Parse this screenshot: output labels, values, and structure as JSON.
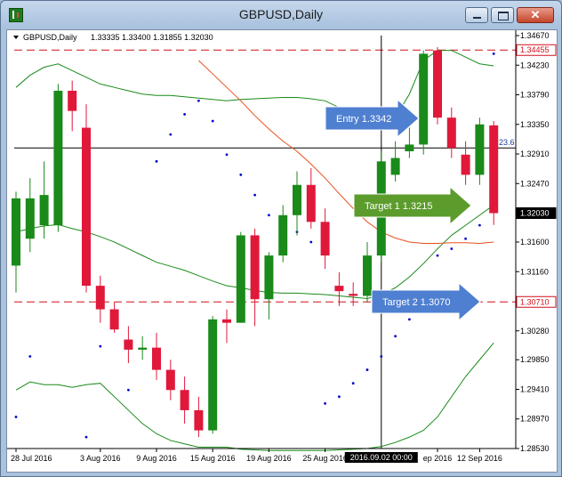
{
  "window": {
    "title": "GBPUSD,Daily",
    "buttons": {
      "minimize": "minimize",
      "maximize": "maximize",
      "close": "✕"
    }
  },
  "chart_info": {
    "symbol_label": "GBPUSD,Daily",
    "ohlc": "1.33335 1.33400 1.31855 1.32030"
  },
  "crosshair_time_label": "2016.09.02 00:00",
  "fib_label": "23.6",
  "colors": {
    "bull": "#1a8a1a",
    "bear": "#e0183a",
    "bollinger": "#1a8a1a",
    "moving_average": "#e8501e",
    "psar_dots": "#0000cc",
    "hline": "#d0101c",
    "callout_fill": "#4f7fd0",
    "target1_fill": "#5c9c2c"
  },
  "annotations": {
    "entry": "Entry 1.3342",
    "target1": "Target  1 1.3215",
    "target2": "Target 2 1.3070"
  },
  "chart_data": {
    "type": "candlestick",
    "title": "GBPUSD,Daily",
    "ylim": [
      1.2853,
      1.3467
    ],
    "y_ticks": [
      "1.34670",
      "1.34230",
      "1.33790",
      "1.33350",
      "1.32910",
      "1.32470",
      "1.31600",
      "1.31160",
      "1.30280",
      "1.29850",
      "1.29410",
      "1.28970",
      "1.28530"
    ],
    "price_labels": [
      {
        "value": 1.34455,
        "text": "1.34455",
        "style": "red"
      },
      {
        "value": 1.3203,
        "text": "1.32030",
        "style": "black"
      },
      {
        "value": 1.3071,
        "text": "1.30710",
        "style": "red"
      }
    ],
    "x_ticks": [
      {
        "index": 0,
        "label": "28 Jul 2016"
      },
      {
        "index": 6,
        "label": "3 Aug 2016"
      },
      {
        "index": 10,
        "label": "9 Aug 2016"
      },
      {
        "index": 14,
        "label": "15 Aug 2016"
      },
      {
        "index": 18,
        "label": "19 Aug 2016"
      },
      {
        "index": 22,
        "label": "25 Aug 2016"
      },
      {
        "index": 30,
        "label": "ep 2016"
      },
      {
        "index": 33,
        "label": "12 Sep 2016"
      }
    ],
    "crosshair": {
      "index": 26,
      "price": 1.33
    },
    "horizontal_lines": [
      1.34455,
      1.3071
    ],
    "candles": [
      {
        "o": 1.3125,
        "h": 1.3235,
        "l": 1.3085,
        "c": 1.3225
      },
      {
        "o": 1.3165,
        "h": 1.3255,
        "l": 1.3145,
        "c": 1.3225
      },
      {
        "o": 1.3185,
        "h": 1.328,
        "l": 1.3165,
        "c": 1.323
      },
      {
        "o": 1.3185,
        "h": 1.3395,
        "l": 1.3175,
        "c": 1.3385
      },
      {
        "o": 1.3385,
        "h": 1.34,
        "l": 1.3325,
        "c": 1.3355
      },
      {
        "o": 1.333,
        "h": 1.3365,
        "l": 1.3085,
        "c": 1.3095
      },
      {
        "o": 1.3095,
        "h": 1.311,
        "l": 1.304,
        "c": 1.306
      },
      {
        "o": 1.306,
        "h": 1.307,
        "l": 1.3025,
        "c": 1.303
      },
      {
        "o": 1.3015,
        "h": 1.3035,
        "l": 1.298,
        "c": 1.3
      },
      {
        "o": 1.3,
        "h": 1.302,
        "l": 1.2985,
        "c": 1.3003
      },
      {
        "o": 1.3003,
        "h": 1.3025,
        "l": 1.2955,
        "c": 1.297
      },
      {
        "o": 1.297,
        "h": 1.2985,
        "l": 1.2925,
        "c": 1.294
      },
      {
        "o": 1.294,
        "h": 1.296,
        "l": 1.289,
        "c": 1.291
      },
      {
        "o": 1.291,
        "h": 1.293,
        "l": 1.287,
        "c": 1.288
      },
      {
        "o": 1.288,
        "h": 1.305,
        "l": 1.2875,
        "c": 1.3045
      },
      {
        "o": 1.3045,
        "h": 1.306,
        "l": 1.301,
        "c": 1.304
      },
      {
        "o": 1.304,
        "h": 1.3175,
        "l": 1.304,
        "c": 1.317
      },
      {
        "o": 1.317,
        "h": 1.318,
        "l": 1.3035,
        "c": 1.3075
      },
      {
        "o": 1.3075,
        "h": 1.3145,
        "l": 1.3045,
        "c": 1.314
      },
      {
        "o": 1.314,
        "h": 1.3215,
        "l": 1.313,
        "c": 1.32
      },
      {
        "o": 1.32,
        "h": 1.3265,
        "l": 1.317,
        "c": 1.3245
      },
      {
        "o": 1.3245,
        "h": 1.327,
        "l": 1.318,
        "c": 1.319
      },
      {
        "o": 1.319,
        "h": 1.321,
        "l": 1.312,
        "c": 1.314
      },
      {
        "o": 1.3095,
        "h": 1.3115,
        "l": 1.3065,
        "c": 1.3087
      },
      {
        "o": 1.3083,
        "h": 1.31,
        "l": 1.3065,
        "c": 1.308
      },
      {
        "o": 1.308,
        "h": 1.316,
        "l": 1.307,
        "c": 1.314
      },
      {
        "o": 1.314,
        "h": 1.3295,
        "l": 1.313,
        "c": 1.328
      },
      {
        "o": 1.326,
        "h": 1.331,
        "l": 1.325,
        "c": 1.3285
      },
      {
        "o": 1.3295,
        "h": 1.333,
        "l": 1.3285,
        "c": 1.3305
      },
      {
        "o": 1.3305,
        "h": 1.3445,
        "l": 1.329,
        "c": 1.344
      },
      {
        "o": 1.3445,
        "h": 1.345,
        "l": 1.3335,
        "c": 1.3345
      },
      {
        "o": 1.3345,
        "h": 1.336,
        "l": 1.3285,
        "c": 1.33
      },
      {
        "o": 1.329,
        "h": 1.331,
        "l": 1.3245,
        "c": 1.326
      },
      {
        "o": 1.326,
        "h": 1.3345,
        "l": 1.3245,
        "c": 1.3335
      },
      {
        "o": 1.33335,
        "h": 1.334,
        "l": 1.31855,
        "c": 1.3203
      }
    ],
    "series": [
      {
        "name": "bb_upper",
        "start": 0,
        "values": [
          1.339,
          1.3408,
          1.342,
          1.3425,
          1.3415,
          1.3405,
          1.3395,
          1.339,
          1.3385,
          1.338,
          1.3378,
          1.3378,
          1.3376,
          1.3374,
          1.3372,
          1.337,
          1.3372,
          1.3373,
          1.3374,
          1.3375,
          1.3375,
          1.3373,
          1.337,
          1.336,
          1.334,
          1.333,
          1.3328,
          1.3345,
          1.338,
          1.343,
          1.3445,
          1.3445,
          1.3435,
          1.3425,
          1.3422
        ]
      },
      {
        "name": "bb_middle",
        "start": 0,
        "values": [
          1.3175,
          1.318,
          1.3184,
          1.3186,
          1.318,
          1.3175,
          1.3168,
          1.316,
          1.315,
          1.314,
          1.313,
          1.3124,
          1.3118,
          1.311,
          1.3102,
          1.3095,
          1.3092,
          1.3088,
          1.3085,
          1.3084,
          1.3084,
          1.3083,
          1.3082,
          1.308,
          1.3078,
          1.3076,
          1.3082,
          1.3092,
          1.3108,
          1.3128,
          1.315,
          1.317,
          1.3185,
          1.32,
          1.3215
        ]
      },
      {
        "name": "bb_lower",
        "start": 0,
        "values": [
          1.294,
          1.2952,
          1.2948,
          1.2948,
          1.2944,
          1.2948,
          1.295,
          1.293,
          1.291,
          1.289,
          1.2875,
          1.2865,
          1.286,
          1.2855,
          1.2855,
          1.2855,
          1.2852,
          1.2851,
          1.285,
          1.285,
          1.285,
          1.285,
          1.285,
          1.2851,
          1.2852,
          1.2853,
          1.2856,
          1.2862,
          1.287,
          1.288,
          1.29,
          1.293,
          1.296,
          1.2985,
          1.301
        ]
      },
      {
        "name": "moving_average",
        "start": 13,
        "values": [
          1.343,
          1.341,
          1.339,
          1.337,
          1.3348,
          1.3328,
          1.331,
          1.3295,
          1.3276,
          1.3255,
          1.3232,
          1.321,
          1.319,
          1.3175,
          1.3166,
          1.316,
          1.3158,
          1.3158,
          1.3159,
          1.3159,
          1.3158,
          1.316
        ]
      },
      {
        "name": "psar",
        "start": 0,
        "values": [
          1.29,
          1.299,
          null,
          null,
          null,
          1.287,
          1.3005,
          null,
          1.294,
          null,
          1.328,
          1.332,
          1.335,
          1.337,
          1.334,
          1.329,
          1.326,
          1.323,
          1.32,
          1.3185,
          1.3175,
          1.316,
          1.292,
          1.293,
          1.295,
          1.297,
          1.299,
          1.302,
          1.3045,
          null,
          1.314,
          1.315,
          1.3165,
          1.3185,
          1.344
        ]
      }
    ]
  }
}
